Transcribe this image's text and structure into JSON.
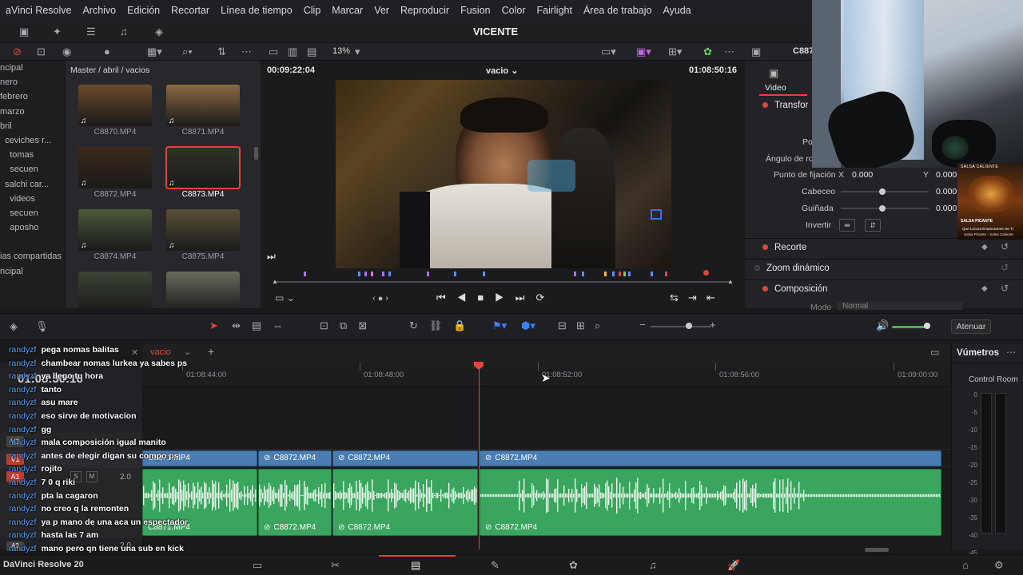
{
  "menubar": {
    "items": [
      "aVinci Resolve",
      "Archivo",
      "Edición",
      "Recortar",
      "Línea de tiempo",
      "Clip",
      "Marcar",
      "Ver",
      "Reproducir",
      "Fusion",
      "Color",
      "Fairlight",
      "Área de trabajo",
      "Ayuda"
    ]
  },
  "project_title": "VICENTE",
  "toolbar": {
    "zoom": "13%",
    "clip_name_right": "C887"
  },
  "media_left": {
    "items": [
      "ncipal",
      "nero",
      "febrero",
      "marzo",
      "bril",
      "  ceviches r...",
      "    tomas",
      "    secuen",
      "  salchi car...",
      "    videos",
      "    secuen",
      "    aposho",
      "",
      "ias compartidas",
      "ncipal"
    ]
  },
  "media_pool": {
    "breadcrumb": "Master / abril / vacios",
    "clips": [
      {
        "label": "C8870.MP4",
        "color": "#6b4a2a"
      },
      {
        "label": "C8871.MP4",
        "color": "#8a6a44"
      },
      {
        "label": "C8872.MP4",
        "color": "#3a2a1a"
      },
      {
        "label": "C8873.MP4",
        "color": "#2e3428"
      },
      {
        "label": "C8874.MP4",
        "color": "#4a5a3a"
      },
      {
        "label": "C8875.MP4",
        "color": "#5a5236"
      },
      {
        "label": "",
        "color": "#3c4434"
      },
      {
        "label": "",
        "color": "#6a6a5a"
      }
    ]
  },
  "viewer": {
    "timecode_left": "00:09:22:04",
    "title": "vacio",
    "timecode_right": "01:08:50:16"
  },
  "inspector": {
    "tab": "Video",
    "sections": {
      "transform": "Transfor",
      "anchor_label": "Punto de fijación",
      "anchor_x_label": "X",
      "anchor_x": "0.000",
      "anchor_y_label": "Y",
      "anchor_y": "0.000",
      "pitch_label": "Cabeceo",
      "pitch": "0.000",
      "yaw_label": "Guiñada",
      "yaw": "0.000",
      "rotation_label": "Ángulo de rot",
      "position_label": "Po",
      "flip_label": "Invertir",
      "crop": "Recorte",
      "dynamic_zoom": "Zoom dinámico",
      "composite": "Composición",
      "mode_label": "Modo",
      "mode_value": "Normal"
    }
  },
  "timeline": {
    "tab_name": "vacio",
    "timecode": "01:08:50:16",
    "ruler": [
      "01:08:44:00",
      "01:08:48:00",
      "01:08:52:00",
      "01:08:56:00",
      "01:09:00:00"
    ],
    "attenuate": "Atenuar",
    "vumeter_title": "Vúmetros",
    "control_room": "Control Room",
    "vu_scale": [
      "0",
      "-5",
      "-10",
      "-15",
      "-20",
      "-25",
      "-30",
      "-35",
      "-40",
      "-45",
      "-50"
    ],
    "tracks": {
      "v2": "V2",
      "v1": "V1",
      "a1": "A1",
      "a1_level": "2.0",
      "a2": "A2",
      "a2_level": "2.0"
    },
    "video_clips": [
      "C8871.MP4",
      "C8872.MP4",
      "C8872.MP4",
      "C8872.MP4"
    ],
    "audio_clips": [
      "C8871.MP4",
      "C8872.MP4",
      "C8872.MP4",
      "C8872.MP4"
    ]
  },
  "chat": {
    "messages": [
      {
        "user": "randyzf",
        "text": "pega nomas balitas"
      },
      {
        "user": "randyzf",
        "text": "chambear nomas lurkea ya sabes ps"
      },
      {
        "user": "randyzf",
        "text": "ya llego tu hora"
      },
      {
        "user": "randyzf",
        "text": "tanto"
      },
      {
        "user": "randyzf",
        "text": "asu mare"
      },
      {
        "user": "randyzf",
        "text": "eso sirve de motivacion"
      },
      {
        "user": "randyzf",
        "text": "gg"
      },
      {
        "user": "randyzf",
        "text": "mala composición igual manito"
      },
      {
        "user": "randyzf",
        "text": "antes de elegir digan su compo ps"
      },
      {
        "user": "randyzf",
        "text": "rojito"
      },
      {
        "user": "randyzf",
        "text": "7 0 q riki"
      },
      {
        "user": "randyzf",
        "text": "pta la cagaron"
      },
      {
        "user": "randyzf",
        "text": "no creo q la remonten"
      },
      {
        "user": "randyzf",
        "text": "ya p mano de una aca un espectador"
      },
      {
        "user": "randyzf",
        "text": "hasta las 7 am"
      },
      {
        "user": "randyzf",
        "text": "mano pero qn tiene una sub en kick"
      }
    ]
  },
  "bottombar": {
    "app_version": "DaVinci Resolve 20"
  },
  "ad": {
    "line1": "SALSA CALIENTE",
    "line2": "SALSA PICANTE",
    "line3": "Que Locura Enamorarme De Ti",
    "line4": "Salsa Picante - Salsa Caliente"
  },
  "colors": {
    "accent_red": "#e0453a",
    "clip_blue": "#4a7eb2",
    "clip_green": "#3aa55e",
    "chat_user": "#5aa0f2"
  }
}
